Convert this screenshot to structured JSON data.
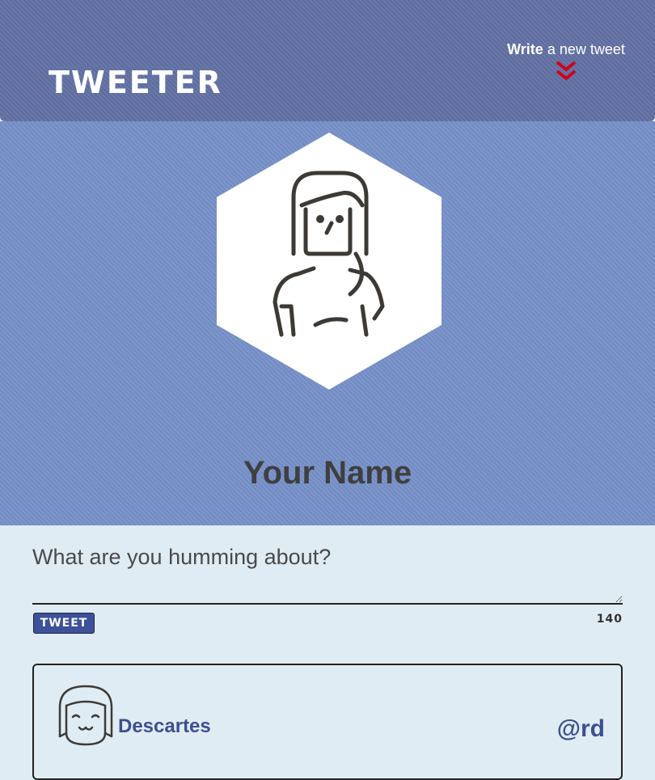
{
  "nav": {
    "logo": "TWEETER",
    "compose_toggle": {
      "bold": "Write",
      "rest": " a new tweet"
    },
    "chevron_icon": "double-chevron-down-icon",
    "accent_color": "#d0021b"
  },
  "profile": {
    "avatar_icon": "woman-avatar-icon",
    "name": "Your Name"
  },
  "compose": {
    "placeholder": "What are you humming about?",
    "button_label": "TWEET",
    "counter": "140"
  },
  "tweets": [
    {
      "avatar_icon": "girl-avatar-icon",
      "name": "Descartes",
      "handle": "@rd"
    }
  ],
  "colors": {
    "nav_bg": "#6271a4",
    "profile_bg": "#7690c8",
    "page_bg": "#e0ecf3",
    "button_bg": "#3d519a",
    "name_text": "#3d4f8f"
  }
}
